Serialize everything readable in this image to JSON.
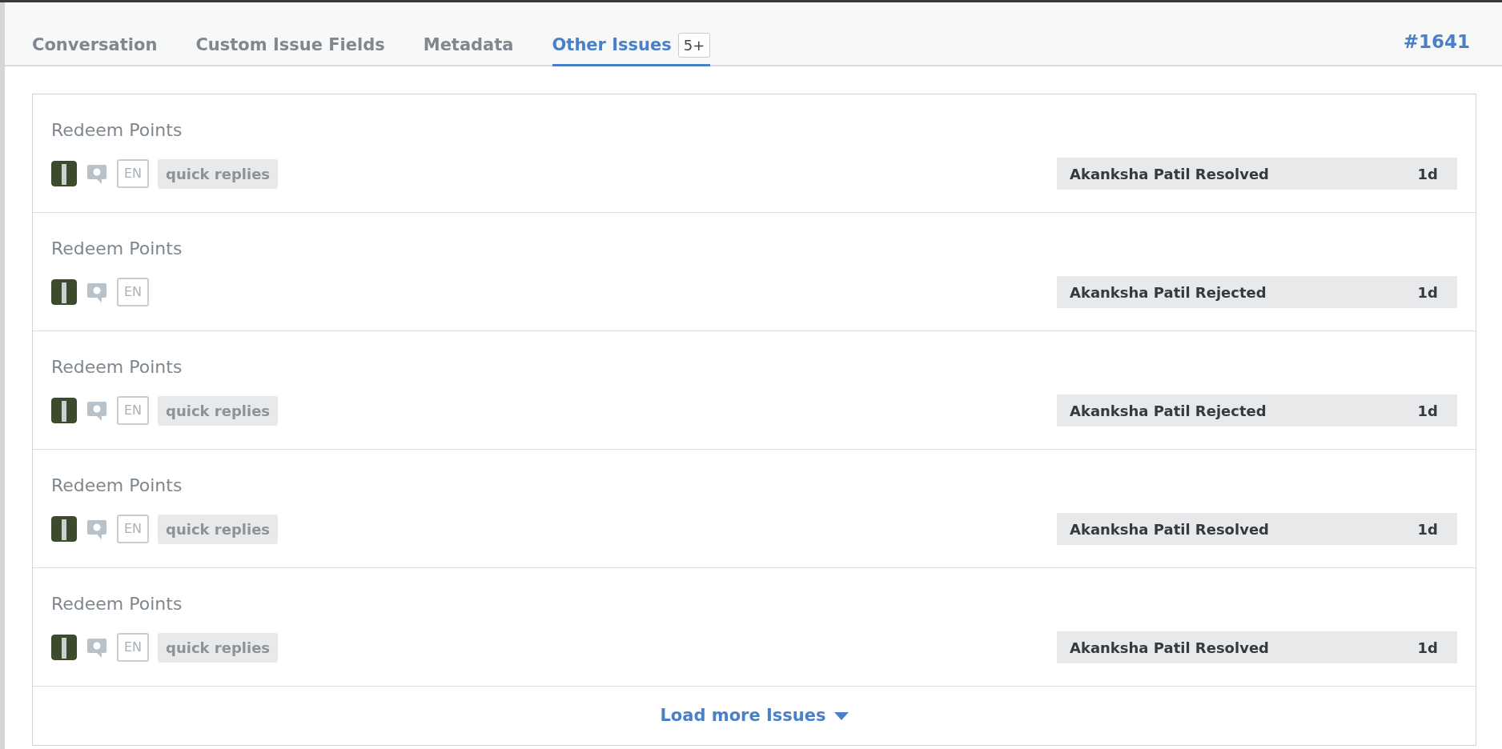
{
  "tabs": [
    {
      "label": "Conversation",
      "selected": false
    },
    {
      "label": "Custom Issue Fields",
      "selected": false
    },
    {
      "label": "Metadata",
      "selected": false
    },
    {
      "label": "Other Issues",
      "selected": true,
      "count": "5+"
    }
  ],
  "issue_number": "#1641",
  "issues": [
    {
      "title": "Redeem Points",
      "language": "EN",
      "tag": "quick replies",
      "status": "Akanksha Patil Resolved",
      "age": "1d"
    },
    {
      "title": "Redeem Points",
      "language": "EN",
      "status": "Akanksha Patil Rejected",
      "age": "1d"
    },
    {
      "title": "Redeem Points",
      "language": "EN",
      "tag": "quick replies",
      "status": "Akanksha Patil Rejected",
      "age": "1d"
    },
    {
      "title": "Redeem Points",
      "language": "EN",
      "tag": "quick replies",
      "status": "Akanksha Patil Resolved",
      "age": "1d"
    },
    {
      "title": "Redeem Points",
      "language": "EN",
      "tag": "quick replies",
      "status": "Akanksha Patil Resolved",
      "age": "1d"
    }
  ],
  "load_more": "Load more Issues"
}
